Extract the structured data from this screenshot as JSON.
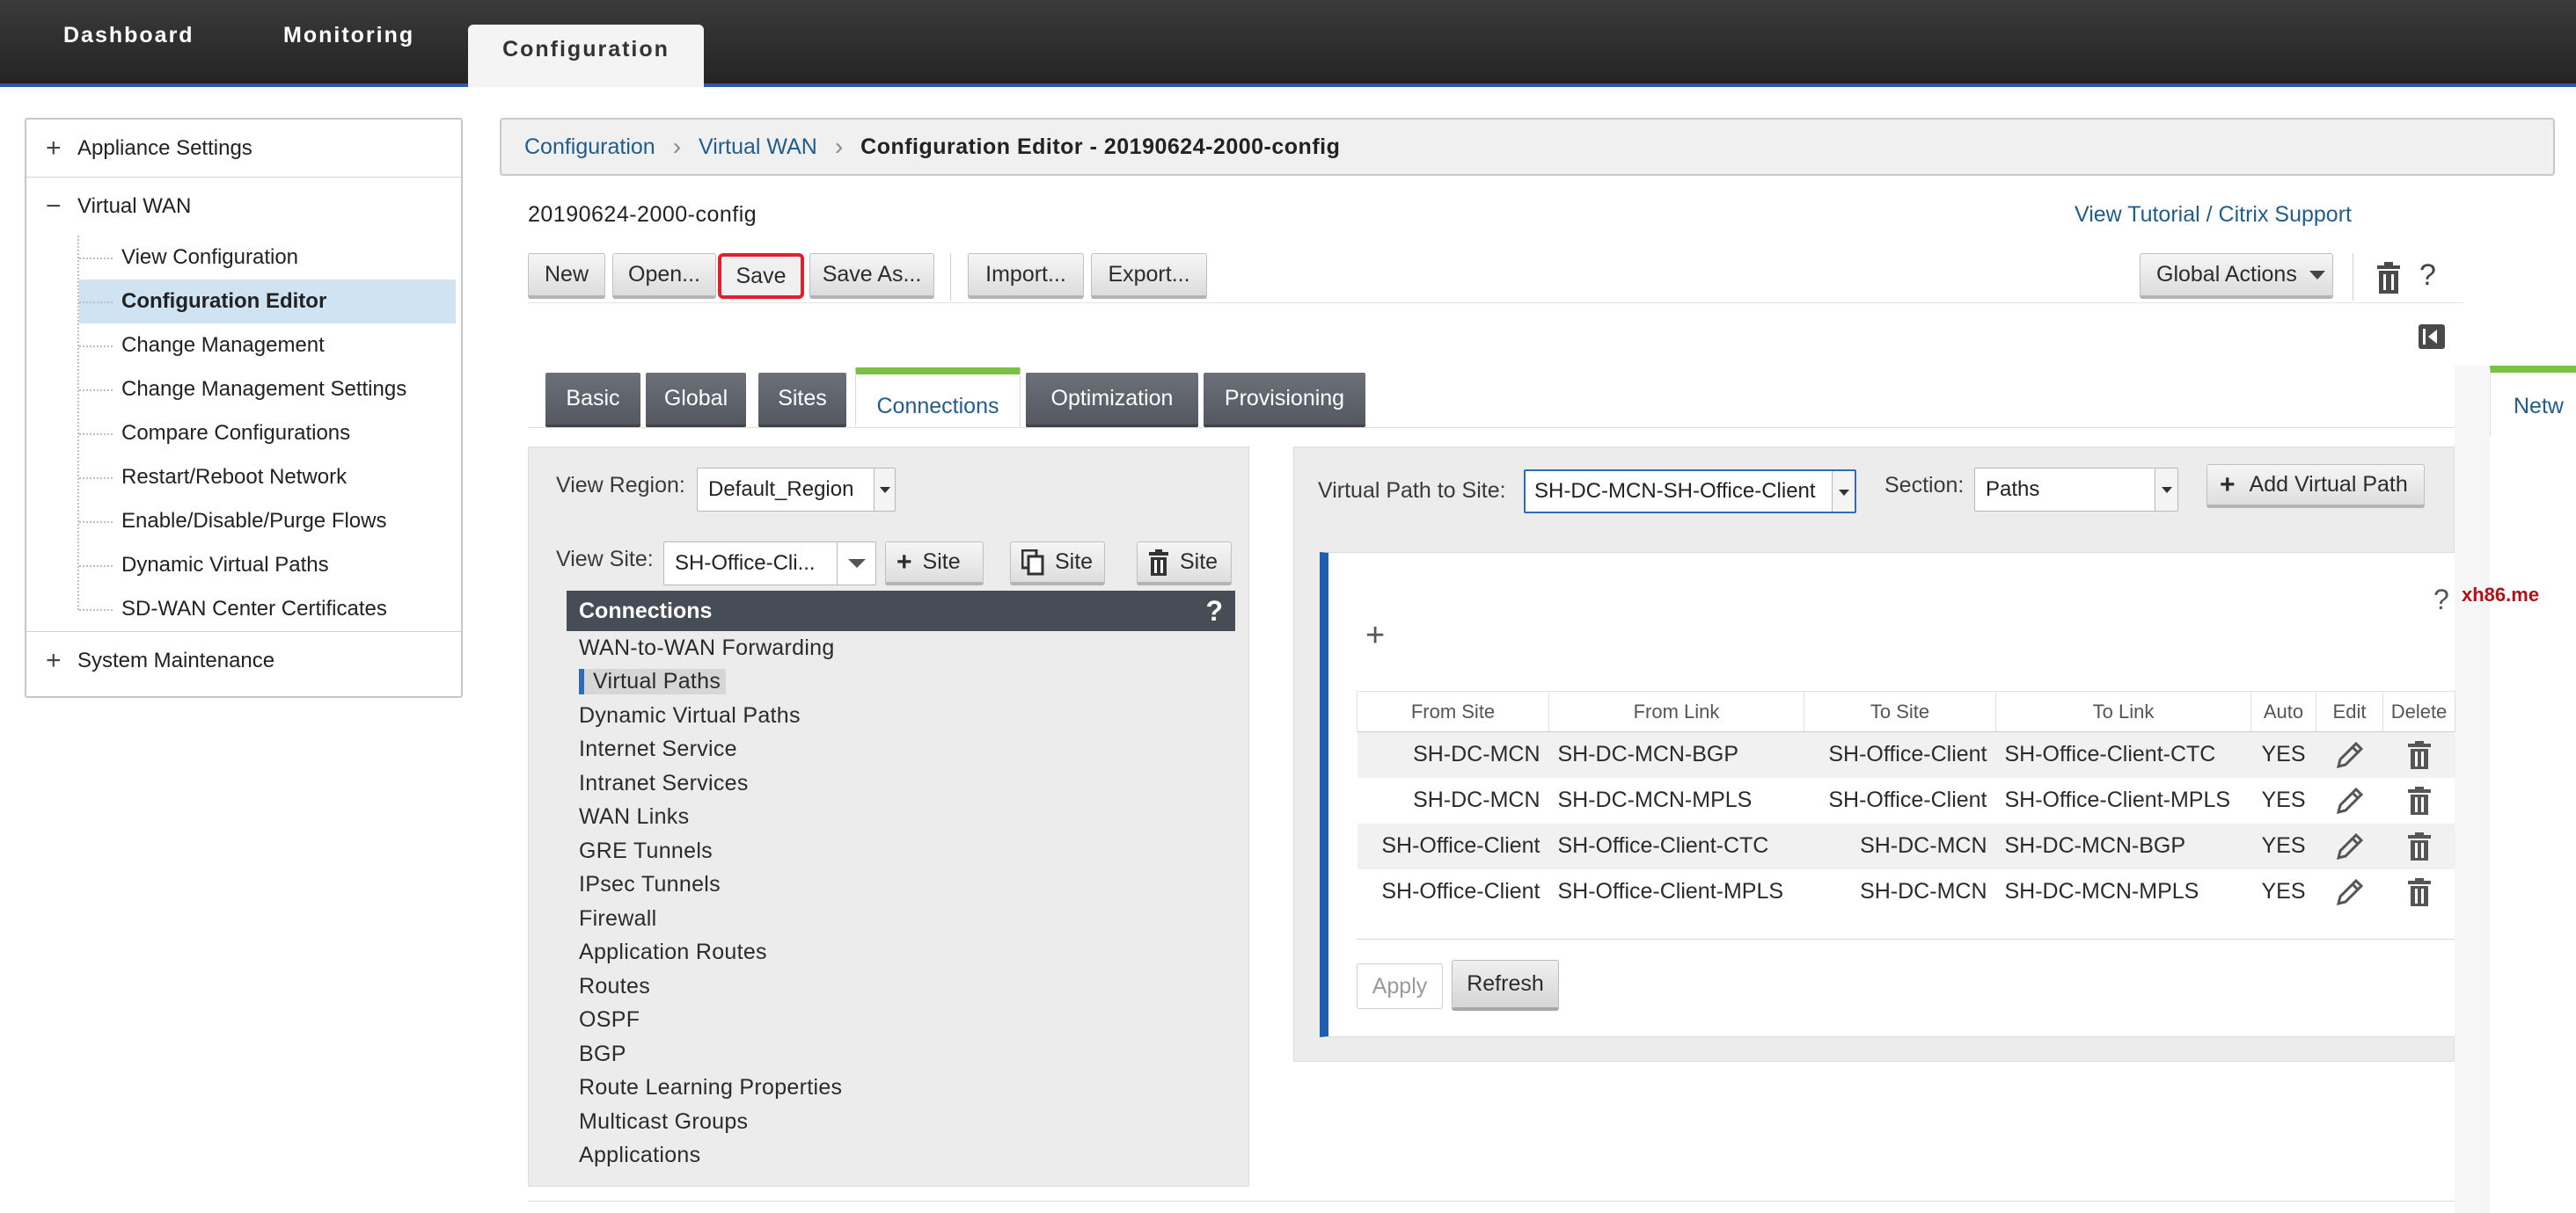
{
  "topnav": {
    "tabs": [
      "Dashboard",
      "Monitoring",
      "Configuration"
    ],
    "active": "Configuration"
  },
  "sidebar": {
    "appliance_settings": "Appliance Settings",
    "virtual_wan": "Virtual WAN",
    "items": [
      "View Configuration",
      "Configuration Editor",
      "Change Management",
      "Change Management Settings",
      "Compare Configurations",
      "Restart/Reboot Network",
      "Enable/Disable/Purge Flows",
      "Dynamic Virtual Paths",
      "SD-WAN Center Certificates"
    ],
    "active_item": "Configuration Editor",
    "system_maintenance": "System Maintenance"
  },
  "breadcrumb": {
    "items": [
      "Configuration",
      "Virtual WAN"
    ],
    "current": "Configuration Editor - 20190624-2000-config"
  },
  "config_name": "20190624-2000-config",
  "help_links": {
    "tutorial": "View Tutorial",
    "separator": "/",
    "support": "Citrix Support"
  },
  "toolbar": {
    "new": "New",
    "open": "Open...",
    "save": "Save",
    "save_as": "Save As...",
    "import": "Import...",
    "export": "Export...",
    "global_actions": "Global Actions",
    "help": "?"
  },
  "tabs": {
    "items": [
      "Basic",
      "Global",
      "Sites",
      "Connections",
      "Optimization",
      "Provisioning"
    ],
    "active": "Connections",
    "right_edge_tab": "Netw"
  },
  "connections_panel": {
    "view_region_label": "View Region:",
    "view_region_value": "Default_Region",
    "view_site_label": "View Site:",
    "view_site_value": "SH-Office-Cli...",
    "site_add": "Site",
    "site_clone": "Site",
    "site_delete": "Site",
    "header": "Connections",
    "header_help": "?",
    "items": [
      "WAN-to-WAN Forwarding",
      "Virtual Paths",
      "Dynamic Virtual Paths",
      "Internet Service",
      "Intranet Services",
      "WAN Links",
      "GRE Tunnels",
      "IPsec Tunnels",
      "Firewall",
      "Application Routes",
      "Routes",
      "OSPF",
      "BGP",
      "Route Learning Properties",
      "Multicast Groups",
      "Applications"
    ],
    "active_item": "Virtual Paths"
  },
  "virtual_path_panel": {
    "path_to_site_label": "Virtual Path to Site:",
    "path_to_site_value": "SH-DC-MCN-SH-Office-Client",
    "section_label": "Section:",
    "section_value": "Paths",
    "add_button": "Add Virtual Path",
    "add_icon": "+",
    "help": "?",
    "watermark": "xh86.me",
    "table": {
      "columns": [
        "From Site",
        "From Link",
        "To Site",
        "To Link",
        "Auto",
        "Edit",
        "Delete"
      ],
      "rows": [
        {
          "from_site": "SH-DC-MCN",
          "from_link": "SH-DC-MCN-BGP",
          "to_site": "SH-Office-Client",
          "to_link": "SH-Office-Client-CTC",
          "auto": "YES"
        },
        {
          "from_site": "SH-DC-MCN",
          "from_link": "SH-DC-MCN-MPLS",
          "to_site": "SH-Office-Client",
          "to_link": "SH-Office-Client-MPLS",
          "auto": "YES"
        },
        {
          "from_site": "SH-Office-Client",
          "from_link": "SH-Office-Client-CTC",
          "to_site": "SH-DC-MCN",
          "to_link": "SH-DC-MCN-BGP",
          "auto": "YES"
        },
        {
          "from_site": "SH-Office-Client",
          "from_link": "SH-Office-Client-MPLS",
          "to_site": "SH-DC-MCN",
          "to_link": "SH-DC-MCN-MPLS",
          "auto": "YES"
        }
      ]
    },
    "apply": "Apply",
    "refresh": "Refresh"
  },
  "colors": {
    "accent_blue": "#1f5d8e",
    "tab_active_green": "#7ac143",
    "save_highlight": "#e0202c",
    "card_border_blue": "#1f5db0"
  },
  "icons": [
    "plus-icon",
    "minus-icon",
    "trash-icon",
    "help-icon",
    "collapse-panel-icon",
    "clone-icon",
    "pencil-icon",
    "chevron-right-icon",
    "caret-down-icon"
  ]
}
